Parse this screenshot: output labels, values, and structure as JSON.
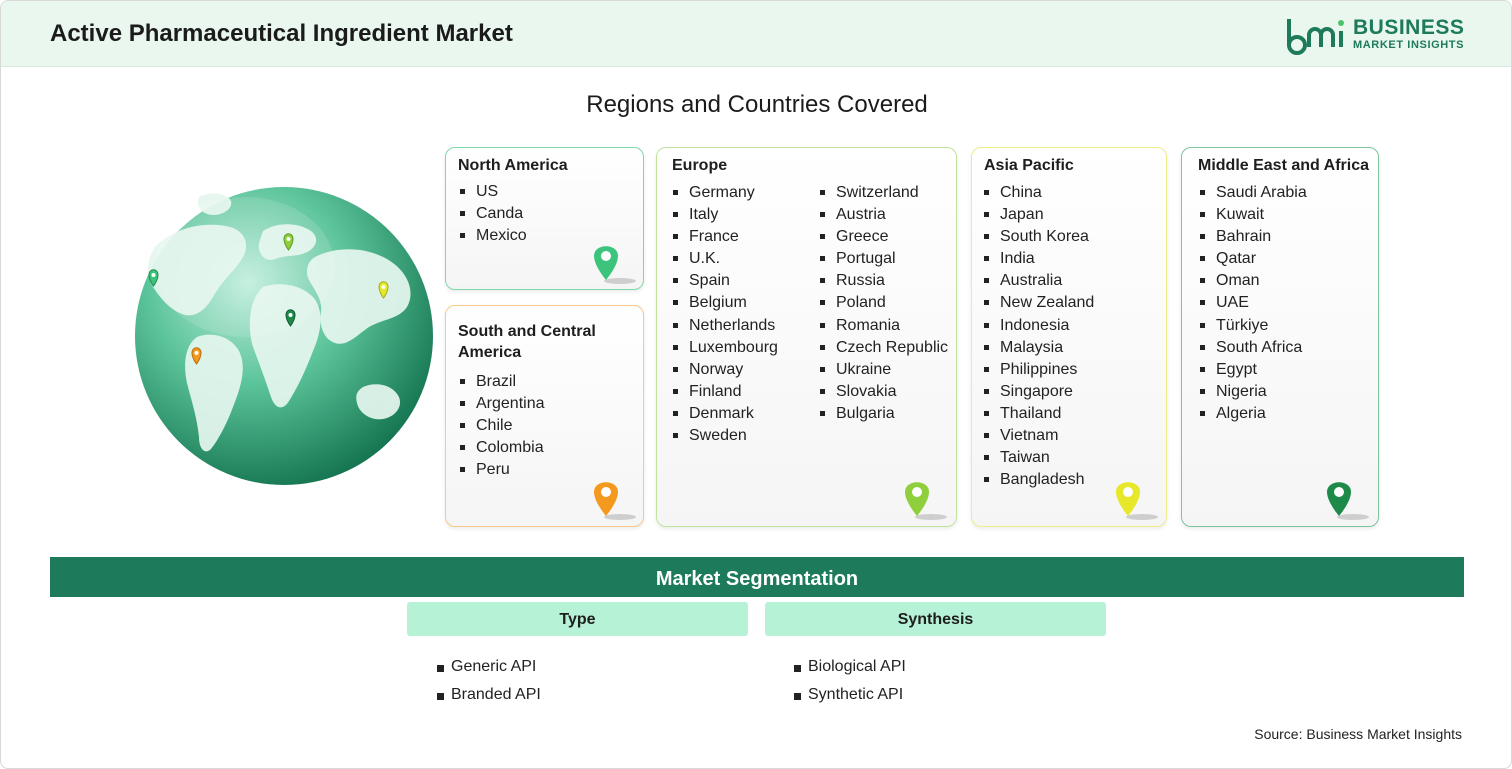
{
  "header": {
    "title": "Active Pharmaceutical Ingredient Market",
    "logo_line1": "BUSINESS",
    "logo_line2": "MARKET INSIGHTS"
  },
  "section_title": "Regions and Countries Covered",
  "regions": [
    {
      "name": "North America",
      "items": [
        "US",
        "Canda",
        "Mexico"
      ],
      "color": "#3cc47c"
    },
    {
      "name": "South and Central America",
      "items": [
        "Brazil",
        "Argentina",
        "Chile",
        "Colombia",
        "Peru"
      ],
      "color": "#f39a1e"
    },
    {
      "name": "Europe",
      "items": [
        "Germany",
        "Italy",
        "France",
        "U.K.",
        "Spain",
        "Belgium",
        "Netherlands",
        "Luxembourg",
        "Norway",
        "Finland",
        "Denmark",
        "Sweden",
        "Switzerland",
        "Austria",
        "Greece",
        "Portugal",
        "Russia",
        "Poland",
        "Romania",
        "Czech Republic",
        "Ukraine",
        "Slovakia",
        "Bulgaria"
      ],
      "color": "#8fcf3c"
    },
    {
      "name": "Asia Pacific",
      "items": [
        "China",
        "Japan",
        "South Korea",
        "India",
        "Australia",
        "New Zealand",
        "Indonesia",
        "Malaysia",
        "Philippines",
        "Singapore",
        "Thailand",
        "Vietnam",
        "Taiwan",
        "Bangladesh"
      ],
      "color": "#e8e82a"
    },
    {
      "name": "Middle East and Africa",
      "items": [
        "Saudi Arabia",
        "Kuwait",
        "Bahrain",
        "Qatar",
        "Oman",
        "UAE",
        "Türkiye",
        "South Africa",
        "Egypt",
        "Nigeria",
        "Algeria"
      ],
      "color": "#1d8a4a"
    }
  ],
  "segmentation": {
    "title": "Market Segmentation",
    "columns": [
      {
        "heading": "Type",
        "items": [
          "Generic API",
          "Branded API"
        ]
      },
      {
        "heading": "Synthesis",
        "items": [
          "Biological API",
          "Synthetic API"
        ]
      }
    ]
  },
  "source": "Source: Business Market Insights",
  "icons": {
    "logo": "bmi-logo-icon",
    "globe": "globe-icon",
    "pin": "location-pin-icon"
  },
  "colors": {
    "brand_green": "#1d7a5a",
    "header_bg": "#e9f7ee",
    "segment_header_bg": "#b6f2d6"
  }
}
